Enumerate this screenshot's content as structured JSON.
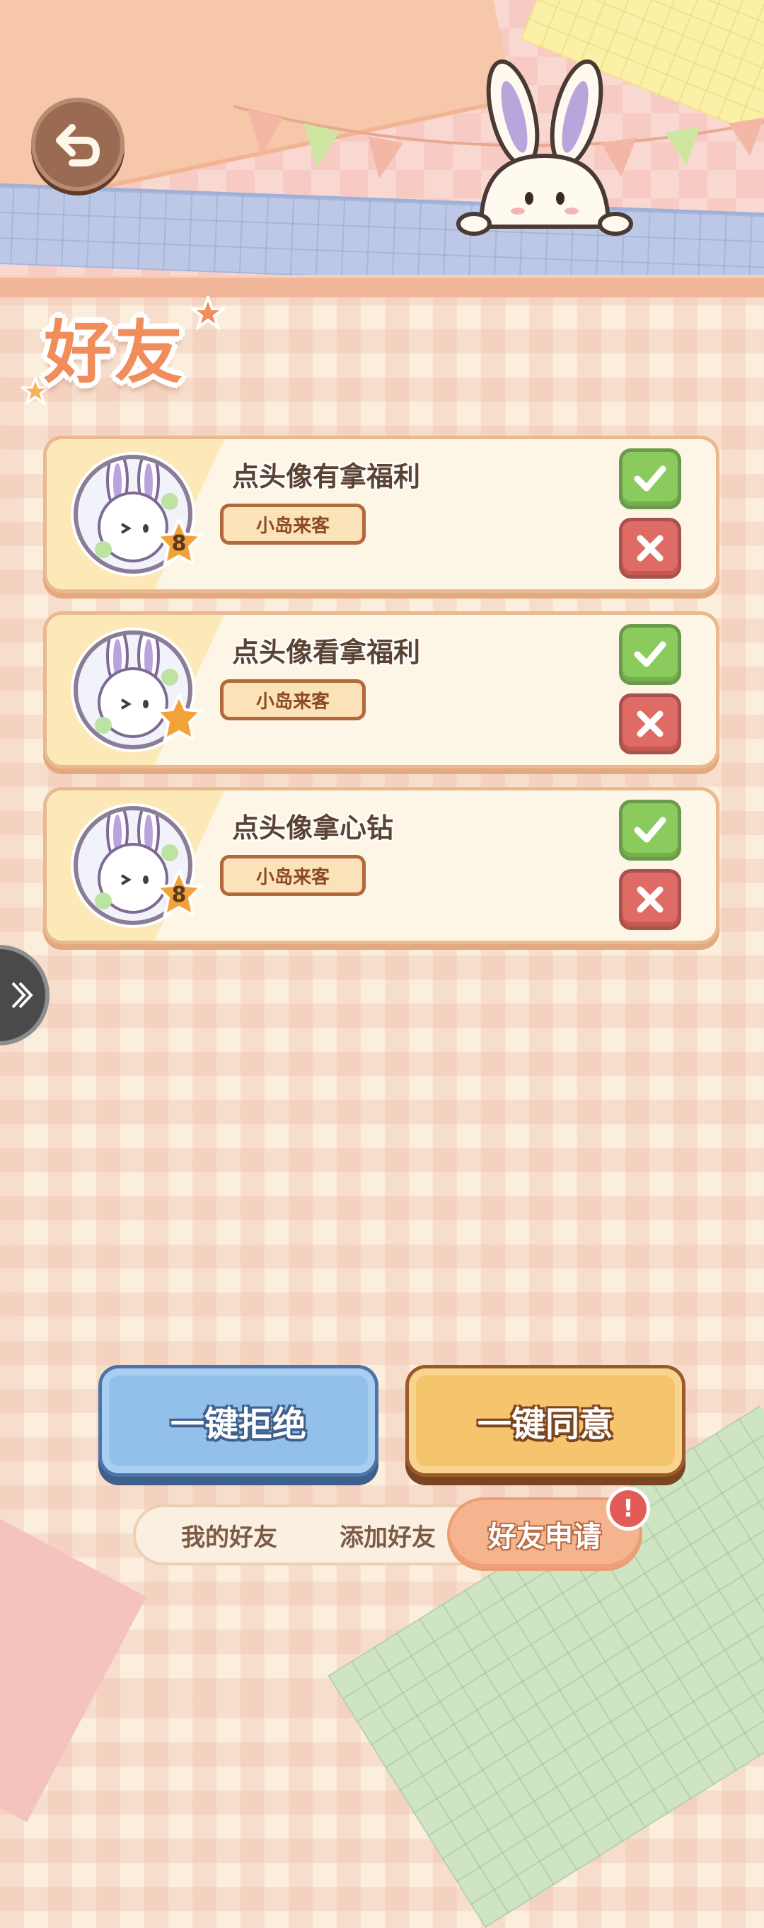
{
  "page": {
    "title": "好友"
  },
  "requests": [
    {
      "name": "点头像有拿福利",
      "tag": "小岛来客",
      "level": "8"
    },
    {
      "name": "点头像看拿福利",
      "tag": "小岛来客",
      "level": ""
    },
    {
      "name": "点头像拿心钻",
      "tag": "小岛来客",
      "level": "8"
    }
  ],
  "actions": {
    "reject_all": "一键拒绝",
    "accept_all": "一键同意"
  },
  "tabs": {
    "my_friends": "我的好友",
    "add_friend": "添加好友",
    "friend_requests": "好友申请",
    "alert": "!"
  },
  "icons": {
    "back": "back-arrow-icon",
    "accept": "check-icon",
    "reject": "close-icon",
    "side": "chevron-right-icon",
    "badge": "star-level-icon"
  },
  "colors": {
    "accent": "#f08d5a",
    "accept_green": "#8bcb5e",
    "reject_red": "#de6c64",
    "reject_all_blue": "#93c0ea",
    "accept_all_yellow": "#f5c56e",
    "active_tab": "#f5b48e"
  }
}
